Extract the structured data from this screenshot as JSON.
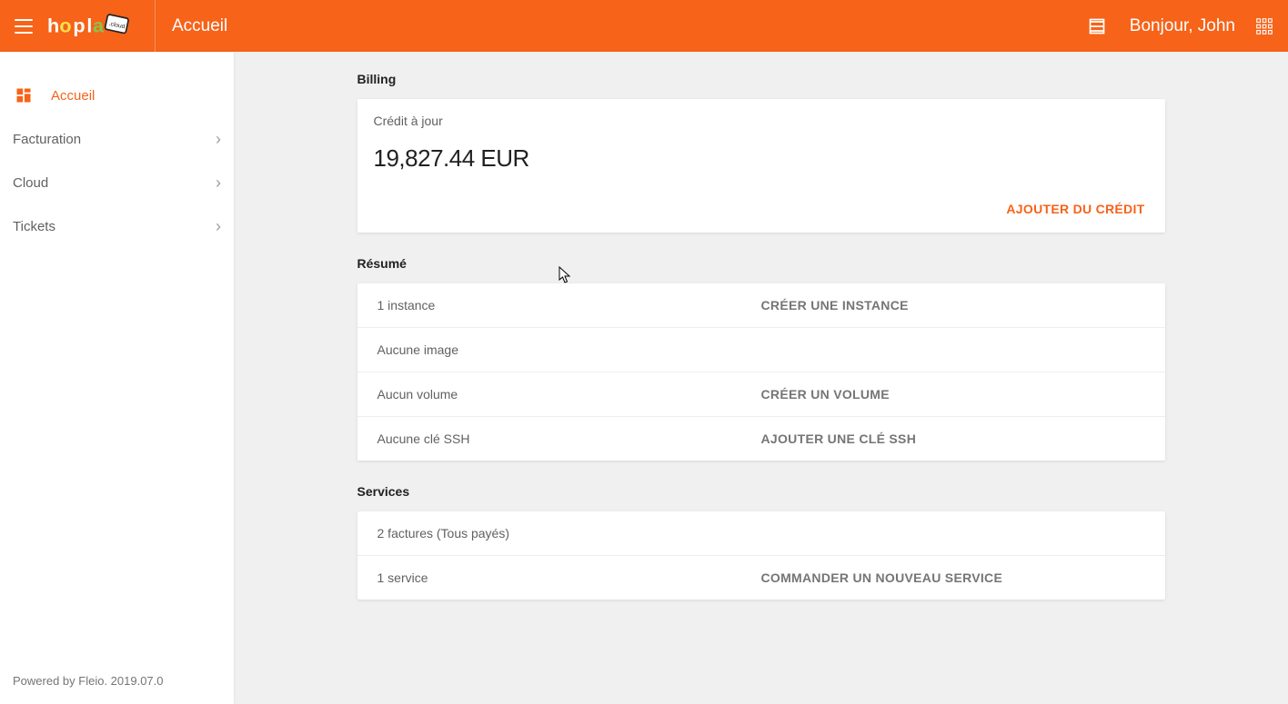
{
  "header": {
    "page_title": "Accueil",
    "greeting": "Bonjour, John"
  },
  "sidebar": {
    "items": [
      {
        "label": "Accueil"
      },
      {
        "label": "Facturation"
      },
      {
        "label": "Cloud"
      },
      {
        "label": "Tickets"
      }
    ]
  },
  "billing": {
    "title": "Billing",
    "credit_label": "Crédit à jour",
    "credit_amount": "19,827.44 EUR",
    "add_credit_btn": "Ajouter du crédit"
  },
  "resume": {
    "title": "Résumé",
    "rows": [
      {
        "text": "1 instance",
        "action": "Créer une instance"
      },
      {
        "text": "Aucune image",
        "action": ""
      },
      {
        "text": "Aucun volume",
        "action": "Créer un volume"
      },
      {
        "text": "Aucune clé SSH",
        "action": "Ajouter une clé SSH"
      }
    ]
  },
  "services": {
    "title": "Services",
    "rows": [
      {
        "text": "2 factures (Tous payés)",
        "action": ""
      },
      {
        "text": "1 service",
        "action": "Commander un nouveau service"
      }
    ]
  },
  "footer": {
    "text": "Powered by Fleio. 2019.07.0"
  }
}
